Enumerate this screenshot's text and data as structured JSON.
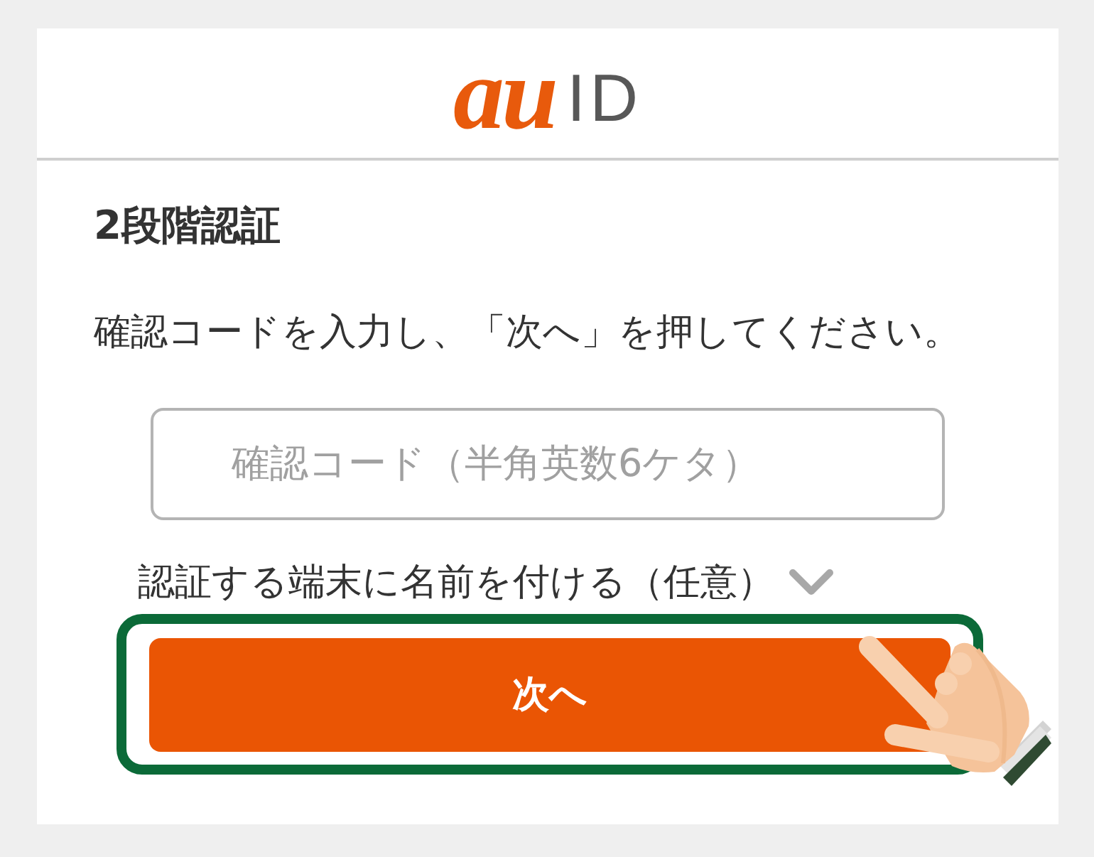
{
  "header": {
    "logo": {
      "brand": "au",
      "product": "ID"
    }
  },
  "title": "2段階認証",
  "instruction": "確認コードを入力し、「次へ」を押してください。",
  "code_field": {
    "placeholder": "確認コード（半角英数6ケタ）"
  },
  "device_name_toggle": {
    "label": "認証する端末に名前を付ける（任意）",
    "expanded": false
  },
  "next_button": {
    "label": "次へ",
    "highlighted": true
  }
}
